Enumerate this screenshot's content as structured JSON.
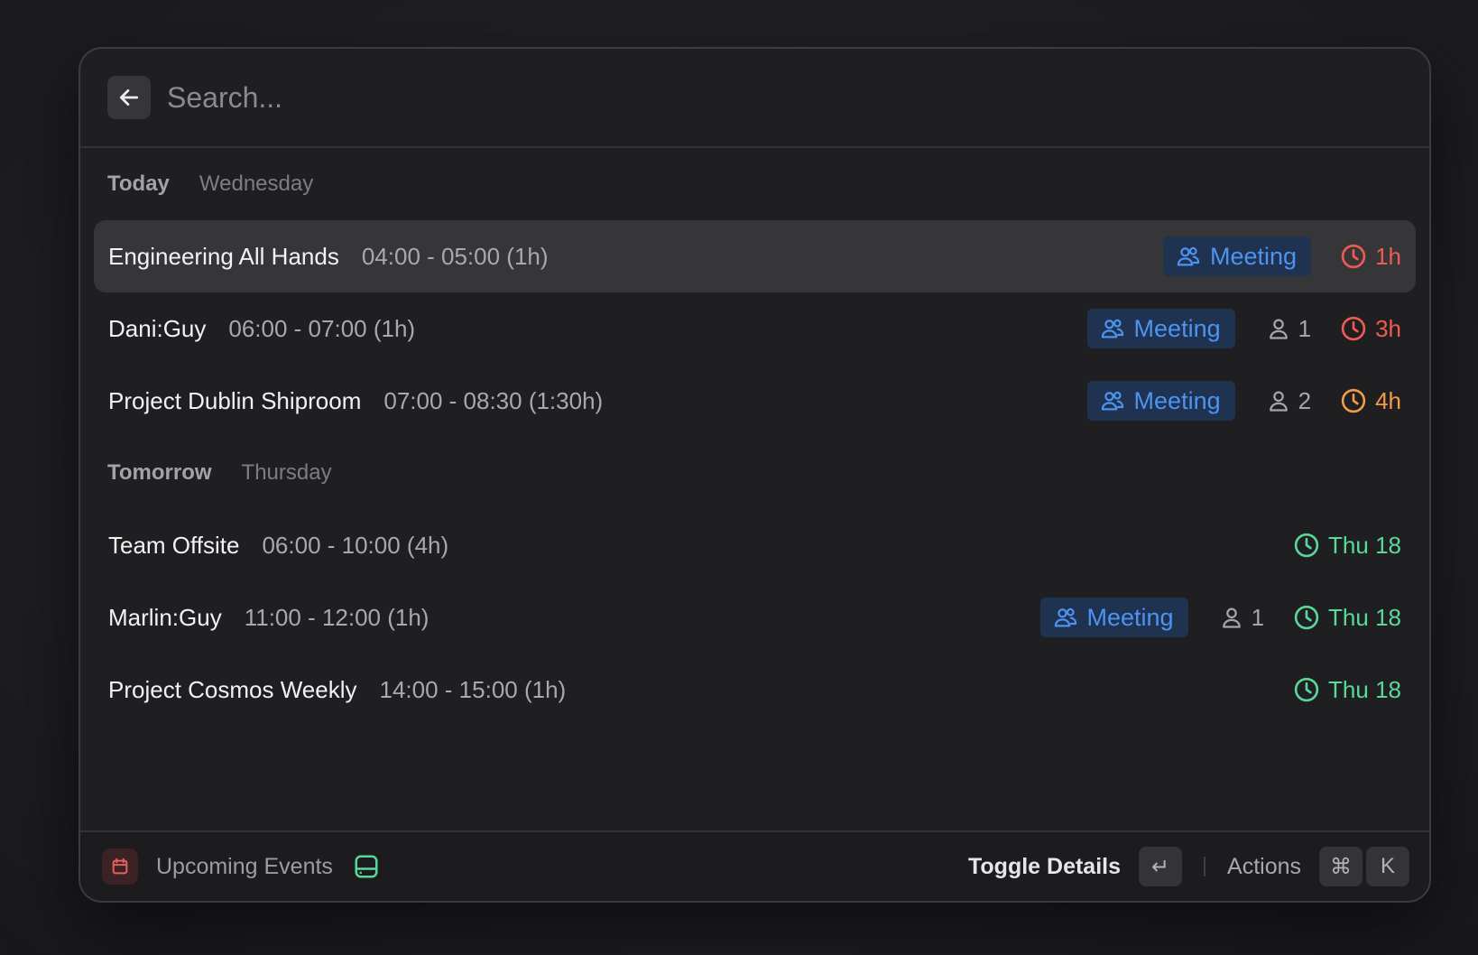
{
  "search": {
    "placeholder": "Search..."
  },
  "sections": [
    {
      "title": "Today",
      "subtitle": "Wednesday",
      "events": [
        {
          "title": "Engineering All Hands",
          "time": "04:00 - 05:00 (1h)",
          "tag": "Meeting",
          "attendees": null,
          "when": "1h",
          "when_color": "#ee5b52",
          "selected": true
        },
        {
          "title": "Dani:Guy",
          "time": "06:00 - 07:00 (1h)",
          "tag": "Meeting",
          "attendees": "1",
          "when": "3h",
          "when_color": "#ee5b52",
          "selected": false
        },
        {
          "title": "Project Dublin Shiproom",
          "time": "07:00 - 08:30 (1:30h)",
          "tag": "Meeting",
          "attendees": "2",
          "when": "4h",
          "when_color": "#f19c45",
          "selected": false
        }
      ]
    },
    {
      "title": "Tomorrow",
      "subtitle": "Thursday",
      "events": [
        {
          "title": "Team Offsite",
          "time": "06:00 - 10:00 (4h)",
          "tag": null,
          "attendees": null,
          "when": "Thu 18",
          "when_color": "#58d89a",
          "selected": false
        },
        {
          "title": "Marlin:Guy",
          "time": "11:00 - 12:00 (1h)",
          "tag": "Meeting",
          "attendees": "1",
          "when": "Thu 18",
          "when_color": "#58d89a",
          "selected": false
        },
        {
          "title": "Project Cosmos Weekly",
          "time": "14:00 - 15:00 (1h)",
          "tag": null,
          "attendees": null,
          "when": "Thu 18",
          "when_color": "#58d89a",
          "selected": false
        }
      ]
    }
  ],
  "footer": {
    "title": "Upcoming Events",
    "primary_action": "Toggle Details",
    "primary_key": "↵",
    "actions_label": "Actions",
    "actions_keys": [
      "⌘",
      "K"
    ]
  },
  "icons": {
    "back": "arrow-left-icon",
    "tag": "people-icon",
    "attendees": "person-icon",
    "when": "clock-icon",
    "app": "calendar-icon",
    "extension": "hard-drive-icon"
  }
}
